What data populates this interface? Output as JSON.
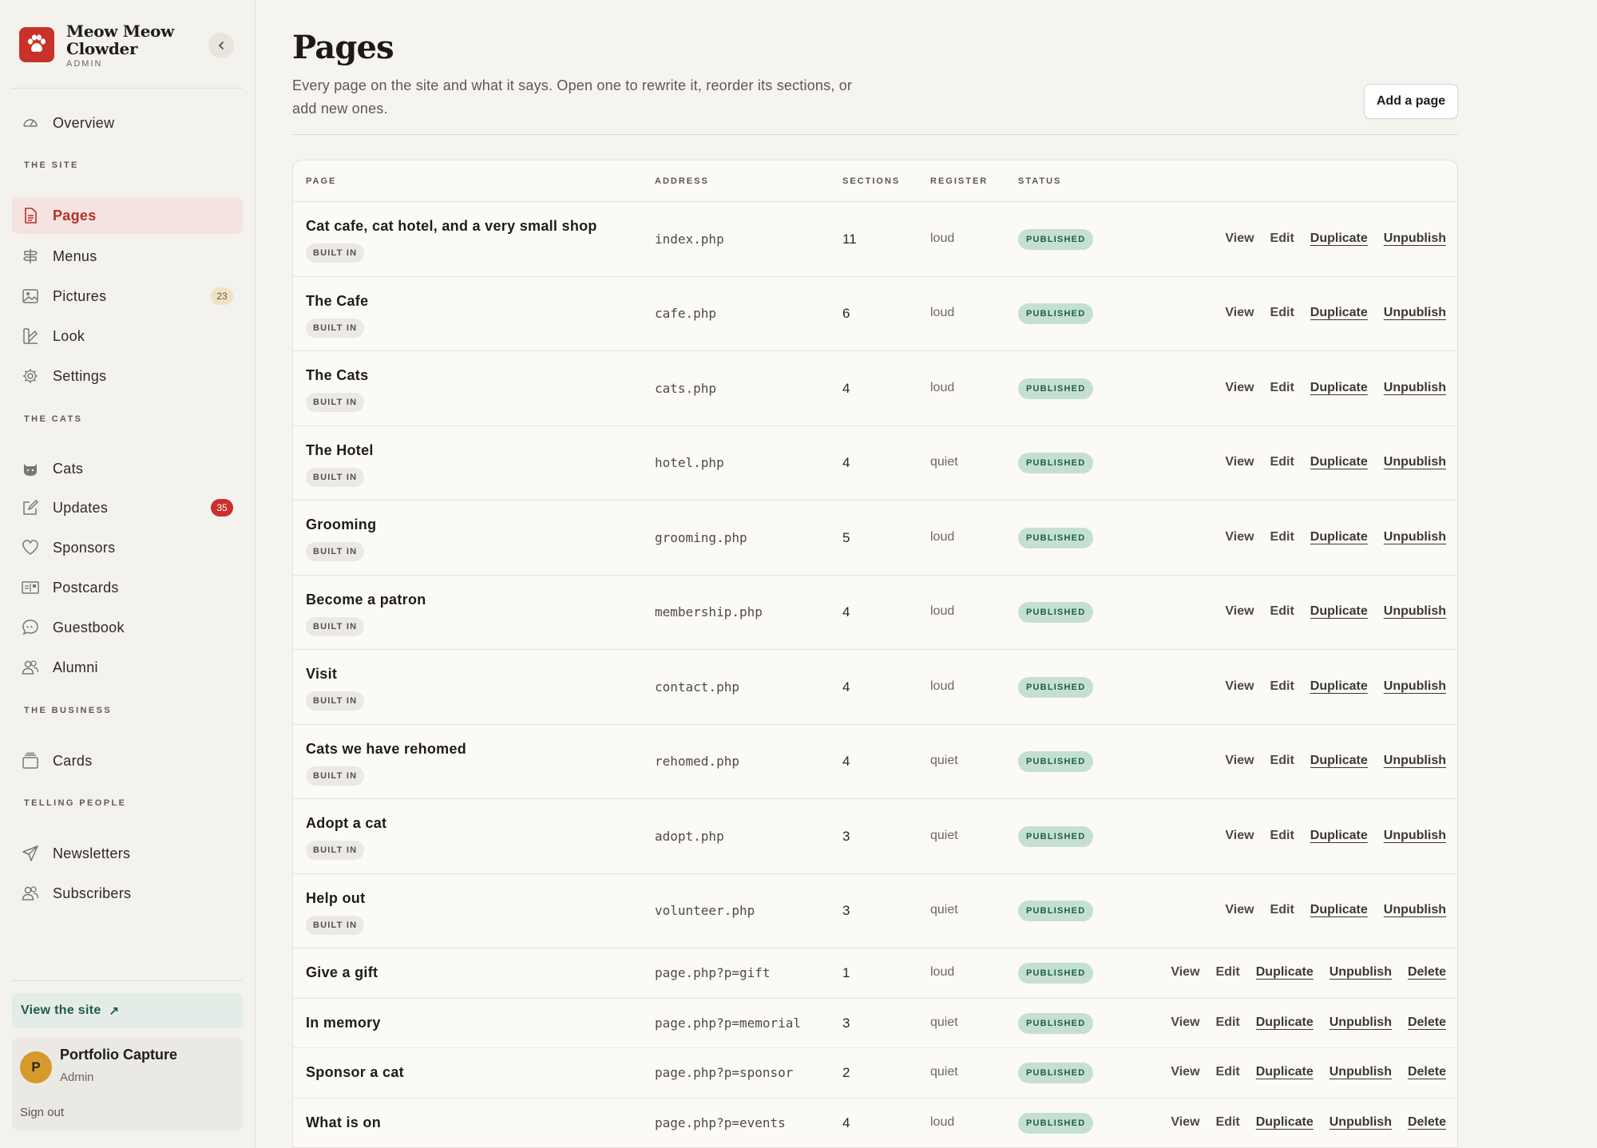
{
  "brand": {
    "name": "Meow Meow Clowder",
    "sub": "ADMIN"
  },
  "nav": {
    "overview": "Overview",
    "section_site": "THE SITE",
    "pages": "Pages",
    "menus": "Menus",
    "pictures": "Pictures",
    "pictures_count": "23",
    "look": "Look",
    "settings": "Settings",
    "section_cats": "THE CATS",
    "cats": "Cats",
    "updates": "Updates",
    "updates_count": "35",
    "sponsors": "Sponsors",
    "postcards": "Postcards",
    "guestbook": "Guestbook",
    "alumni": "Alumni",
    "section_business": "THE BUSINESS",
    "cards": "Cards",
    "section_telling": "TELLING PEOPLE",
    "newsletters": "Newsletters",
    "subscribers": "Subscribers"
  },
  "view_site": {
    "label": "View the site",
    "arrow": "↗"
  },
  "user": {
    "initial": "P",
    "name": "Portfolio Capture",
    "role": "Admin",
    "sign_out": "Sign out"
  },
  "header": {
    "title": "Pages",
    "description": "Every page on the site and what it says. Open one to rewrite it, reorder its sections, or add new ones.",
    "add_button": "Add a page"
  },
  "table": {
    "columns": {
      "page": "PAGE",
      "address": "ADDRESS",
      "sections": "SECTIONS",
      "register": "REGISTER",
      "status": "STATUS"
    },
    "built_in_label": "BUILT IN",
    "actions": {
      "view": "View",
      "edit": "Edit",
      "duplicate": "Duplicate",
      "unpublish": "Unpublish",
      "delete": "Delete"
    },
    "rows": [
      {
        "title": "Cat cafe, cat hotel, and a very small shop",
        "address": "index.php",
        "sections": "11",
        "register": "loud",
        "status": "PUBLISHED"
      },
      {
        "title": "The Cafe",
        "address": "cafe.php",
        "sections": "6",
        "register": "loud",
        "status": "PUBLISHED"
      },
      {
        "title": "The Cats",
        "address": "cats.php",
        "sections": "4",
        "register": "loud",
        "status": "PUBLISHED"
      },
      {
        "title": "The Hotel",
        "address": "hotel.php",
        "sections": "4",
        "register": "quiet",
        "status": "PUBLISHED"
      },
      {
        "title": "Grooming",
        "address": "grooming.php",
        "sections": "5",
        "register": "loud",
        "status": "PUBLISHED"
      },
      {
        "title": "Become a patron",
        "address": "membership.php",
        "sections": "4",
        "register": "loud",
        "status": "PUBLISHED"
      },
      {
        "title": "Visit",
        "address": "contact.php",
        "sections": "4",
        "register": "loud",
        "status": "PUBLISHED"
      },
      {
        "title": "Cats we have rehomed",
        "address": "rehomed.php",
        "sections": "4",
        "register": "quiet",
        "status": "PUBLISHED"
      },
      {
        "title": "Adopt a cat",
        "address": "adopt.php",
        "sections": "3",
        "register": "quiet",
        "status": "PUBLISHED"
      },
      {
        "title": "Help out",
        "address": "volunteer.php",
        "sections": "3",
        "register": "quiet",
        "status": "PUBLISHED"
      },
      {
        "title": "Give a gift",
        "address": "page.php?p=gift",
        "sections": "1",
        "register": "loud",
        "status": "PUBLISHED"
      },
      {
        "title": "In memory",
        "address": "page.php?p=memorial",
        "sections": "3",
        "register": "quiet",
        "status": "PUBLISHED"
      },
      {
        "title": "Sponsor a cat",
        "address": "page.php?p=sponsor",
        "sections": "2",
        "register": "quiet",
        "status": "PUBLISHED"
      },
      {
        "title": "What is on",
        "address": "page.php?p=events",
        "sections": "4",
        "register": "loud",
        "status": "PUBLISHED"
      }
    ]
  },
  "colors": {
    "accent": "#c8322b",
    "active_bg": "#f4e3e0",
    "published_bg": "#c5e0d2",
    "published_text": "#1c5e44"
  }
}
